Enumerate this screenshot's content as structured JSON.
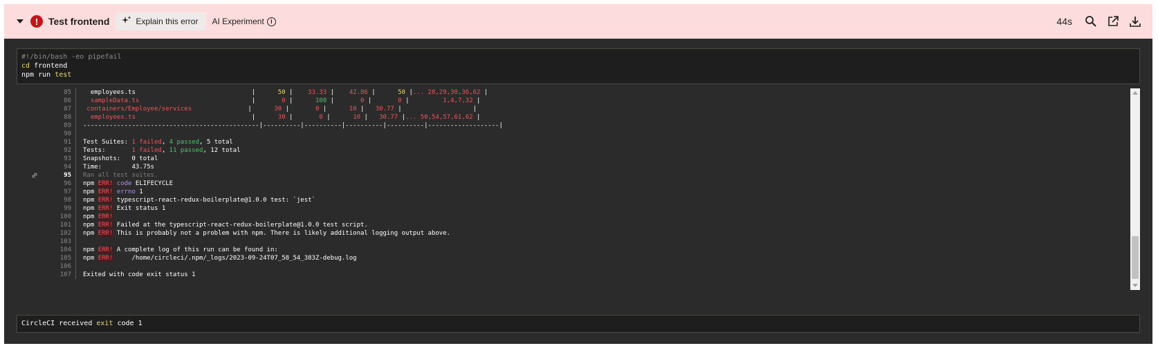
{
  "header": {
    "title": "Test frontend",
    "explain_label": "Explain this error",
    "ai_label": "AI Experiment",
    "duration": "44s"
  },
  "command": {
    "shebang": "#!/bin/bash -eo pipefail",
    "cd_kw": "cd",
    "cd_arg": "frontend",
    "npm_kw": "npm run",
    "npm_arg": "test"
  },
  "log": {
    "active_line": "95",
    "lines": [
      {
        "n": "85",
        "segs": [
          {
            "t": "  employees.ts                               |      ",
            "c": "w"
          },
          {
            "t": "50",
            "c": "y"
          },
          {
            "t": " |    ",
            "c": "w"
          },
          {
            "t": "33.33",
            "c": "r"
          },
          {
            "t": " |    ",
            "c": "w"
          },
          {
            "t": "42.86",
            "c": "r"
          },
          {
            "t": " |      ",
            "c": "w"
          },
          {
            "t": "50",
            "c": "y"
          },
          {
            "t": " |",
            "c": "w"
          },
          {
            "t": "... 28,29,30,36,62",
            "c": "r"
          },
          {
            "t": " |",
            "c": "w"
          }
        ]
      },
      {
        "n": "86",
        "segs": [
          {
            "t": "  ",
            "c": "w"
          },
          {
            "t": "sampleData.ts",
            "c": "r"
          },
          {
            "t": "                              |       ",
            "c": "w"
          },
          {
            "t": "0",
            "c": "r"
          },
          {
            "t": " |      ",
            "c": "w"
          },
          {
            "t": "100",
            "c": "g"
          },
          {
            "t": " |       ",
            "c": "w"
          },
          {
            "t": "0",
            "c": "r"
          },
          {
            "t": " |       ",
            "c": "w"
          },
          {
            "t": "0",
            "c": "r"
          },
          {
            "t": " |         ",
            "c": "w"
          },
          {
            "t": "1,4,7,32",
            "c": "r"
          },
          {
            "t": " |",
            "c": "w"
          }
        ]
      },
      {
        "n": "87",
        "segs": [
          {
            "t": " ",
            "c": "w"
          },
          {
            "t": "containers/Employee/services",
            "c": "r"
          },
          {
            "t": "               |      ",
            "c": "w"
          },
          {
            "t": "30",
            "c": "r"
          },
          {
            "t": " |       ",
            "c": "w"
          },
          {
            "t": "0",
            "c": "r"
          },
          {
            "t": " |      ",
            "c": "w"
          },
          {
            "t": "10",
            "c": "r"
          },
          {
            "t": " |   ",
            "c": "w"
          },
          {
            "t": "30.77",
            "c": "r"
          },
          {
            "t": " |                   |",
            "c": "w"
          }
        ]
      },
      {
        "n": "88",
        "segs": [
          {
            "t": "  ",
            "c": "w"
          },
          {
            "t": "employees.ts",
            "c": "r"
          },
          {
            "t": "                               |      ",
            "c": "w"
          },
          {
            "t": "30",
            "c": "r"
          },
          {
            "t": " |       ",
            "c": "w"
          },
          {
            "t": "0",
            "c": "r"
          },
          {
            "t": " |      ",
            "c": "w"
          },
          {
            "t": "10",
            "c": "r"
          },
          {
            "t": " |   ",
            "c": "w"
          },
          {
            "t": "30.77",
            "c": "r"
          },
          {
            "t": " |",
            "c": "w"
          },
          {
            "t": "... 50,54,57,61,62",
            "c": "r"
          },
          {
            "t": " |",
            "c": "w"
          }
        ]
      },
      {
        "n": "89",
        "segs": [
          {
            "t": "-----------------------------------------------|----------|----------|----------|----------|-------------------|",
            "c": "w"
          }
        ]
      },
      {
        "n": "90",
        "segs": []
      },
      {
        "n": "91",
        "segs": [
          {
            "t": "Test Suites: ",
            "c": "w"
          },
          {
            "t": "1 failed",
            "c": "r"
          },
          {
            "t": ", ",
            "c": "w"
          },
          {
            "t": "4 passed",
            "c": "g"
          },
          {
            "t": ", 5 total",
            "c": "w"
          }
        ]
      },
      {
        "n": "92",
        "segs": [
          {
            "t": "Tests:       ",
            "c": "w"
          },
          {
            "t": "1 failed",
            "c": "r"
          },
          {
            "t": ", ",
            "c": "w"
          },
          {
            "t": "11 passed",
            "c": "g"
          },
          {
            "t": ", 12 total",
            "c": "w"
          }
        ]
      },
      {
        "n": "93",
        "segs": [
          {
            "t": "Snapshots:   0 total",
            "c": "w"
          }
        ]
      },
      {
        "n": "94",
        "segs": [
          {
            "t": "Time:        43.75s",
            "c": "w"
          }
        ]
      },
      {
        "n": "95",
        "segs": [
          {
            "t": "Ran all test suites.",
            "c": "d"
          }
        ]
      },
      {
        "n": "96",
        "segs": [
          {
            "t": "npm ",
            "c": "w"
          },
          {
            "t": "ERR!",
            "c": "e"
          },
          {
            "t": " ",
            "c": "w"
          },
          {
            "t": "code",
            "c": "p"
          },
          {
            "t": " ELIFECYCLE",
            "c": "w"
          }
        ]
      },
      {
        "n": "97",
        "segs": [
          {
            "t": "npm ",
            "c": "w"
          },
          {
            "t": "ERR!",
            "c": "e"
          },
          {
            "t": " ",
            "c": "w"
          },
          {
            "t": "errno",
            "c": "p"
          },
          {
            "t": " 1",
            "c": "w"
          }
        ]
      },
      {
        "n": "98",
        "segs": [
          {
            "t": "npm ",
            "c": "w"
          },
          {
            "t": "ERR!",
            "c": "e"
          },
          {
            "t": " typescript-react-redux-boilerplate@1.0.0 test: `jest`",
            "c": "w"
          }
        ]
      },
      {
        "n": "99",
        "segs": [
          {
            "t": "npm ",
            "c": "w"
          },
          {
            "t": "ERR!",
            "c": "e"
          },
          {
            "t": " Exit status 1",
            "c": "w"
          }
        ]
      },
      {
        "n": "100",
        "segs": [
          {
            "t": "npm ",
            "c": "w"
          },
          {
            "t": "ERR!",
            "c": "e"
          }
        ]
      },
      {
        "n": "101",
        "segs": [
          {
            "t": "npm ",
            "c": "w"
          },
          {
            "t": "ERR!",
            "c": "e"
          },
          {
            "t": " Failed at the typescript-react-redux-boilerplate@1.0.0 test script.",
            "c": "w"
          }
        ]
      },
      {
        "n": "102",
        "segs": [
          {
            "t": "npm ",
            "c": "w"
          },
          {
            "t": "ERR!",
            "c": "e"
          },
          {
            "t": " This is probably not a problem with npm. There is likely additional logging output above.",
            "c": "w"
          }
        ]
      },
      {
        "n": "103",
        "segs": []
      },
      {
        "n": "104",
        "segs": [
          {
            "t": "npm ",
            "c": "w"
          },
          {
            "t": "ERR!",
            "c": "e"
          },
          {
            "t": " A complete log of this run can be found in:",
            "c": "w"
          }
        ]
      },
      {
        "n": "105",
        "segs": [
          {
            "t": "npm ",
            "c": "w"
          },
          {
            "t": "ERR!",
            "c": "e"
          },
          {
            "t": "     /home/circleci/.npm/_logs/2023-09-24T07_58_54_383Z-debug.log",
            "c": "w"
          }
        ]
      },
      {
        "n": "106",
        "segs": []
      },
      {
        "n": "107",
        "segs": [
          {
            "t": "Exited with code exit status 1",
            "c": "w"
          }
        ]
      }
    ]
  },
  "footer": {
    "prefix": "CircleCI received ",
    "keyword": "exit",
    "suffix": " code 1"
  },
  "icons": {
    "status": "error-circle-icon",
    "explain": "sparkle-icon",
    "info": "info-icon",
    "search": "search-icon",
    "open": "external-link-icon",
    "download": "download-icon",
    "link": "link-icon"
  },
  "colors": {
    "header_bg": "#fcdcdc",
    "error": "#c4141a",
    "terminal_bg": "#2b2b2b",
    "red": "#f2545b",
    "green": "#4ec26c",
    "yellow": "#e6db74"
  }
}
